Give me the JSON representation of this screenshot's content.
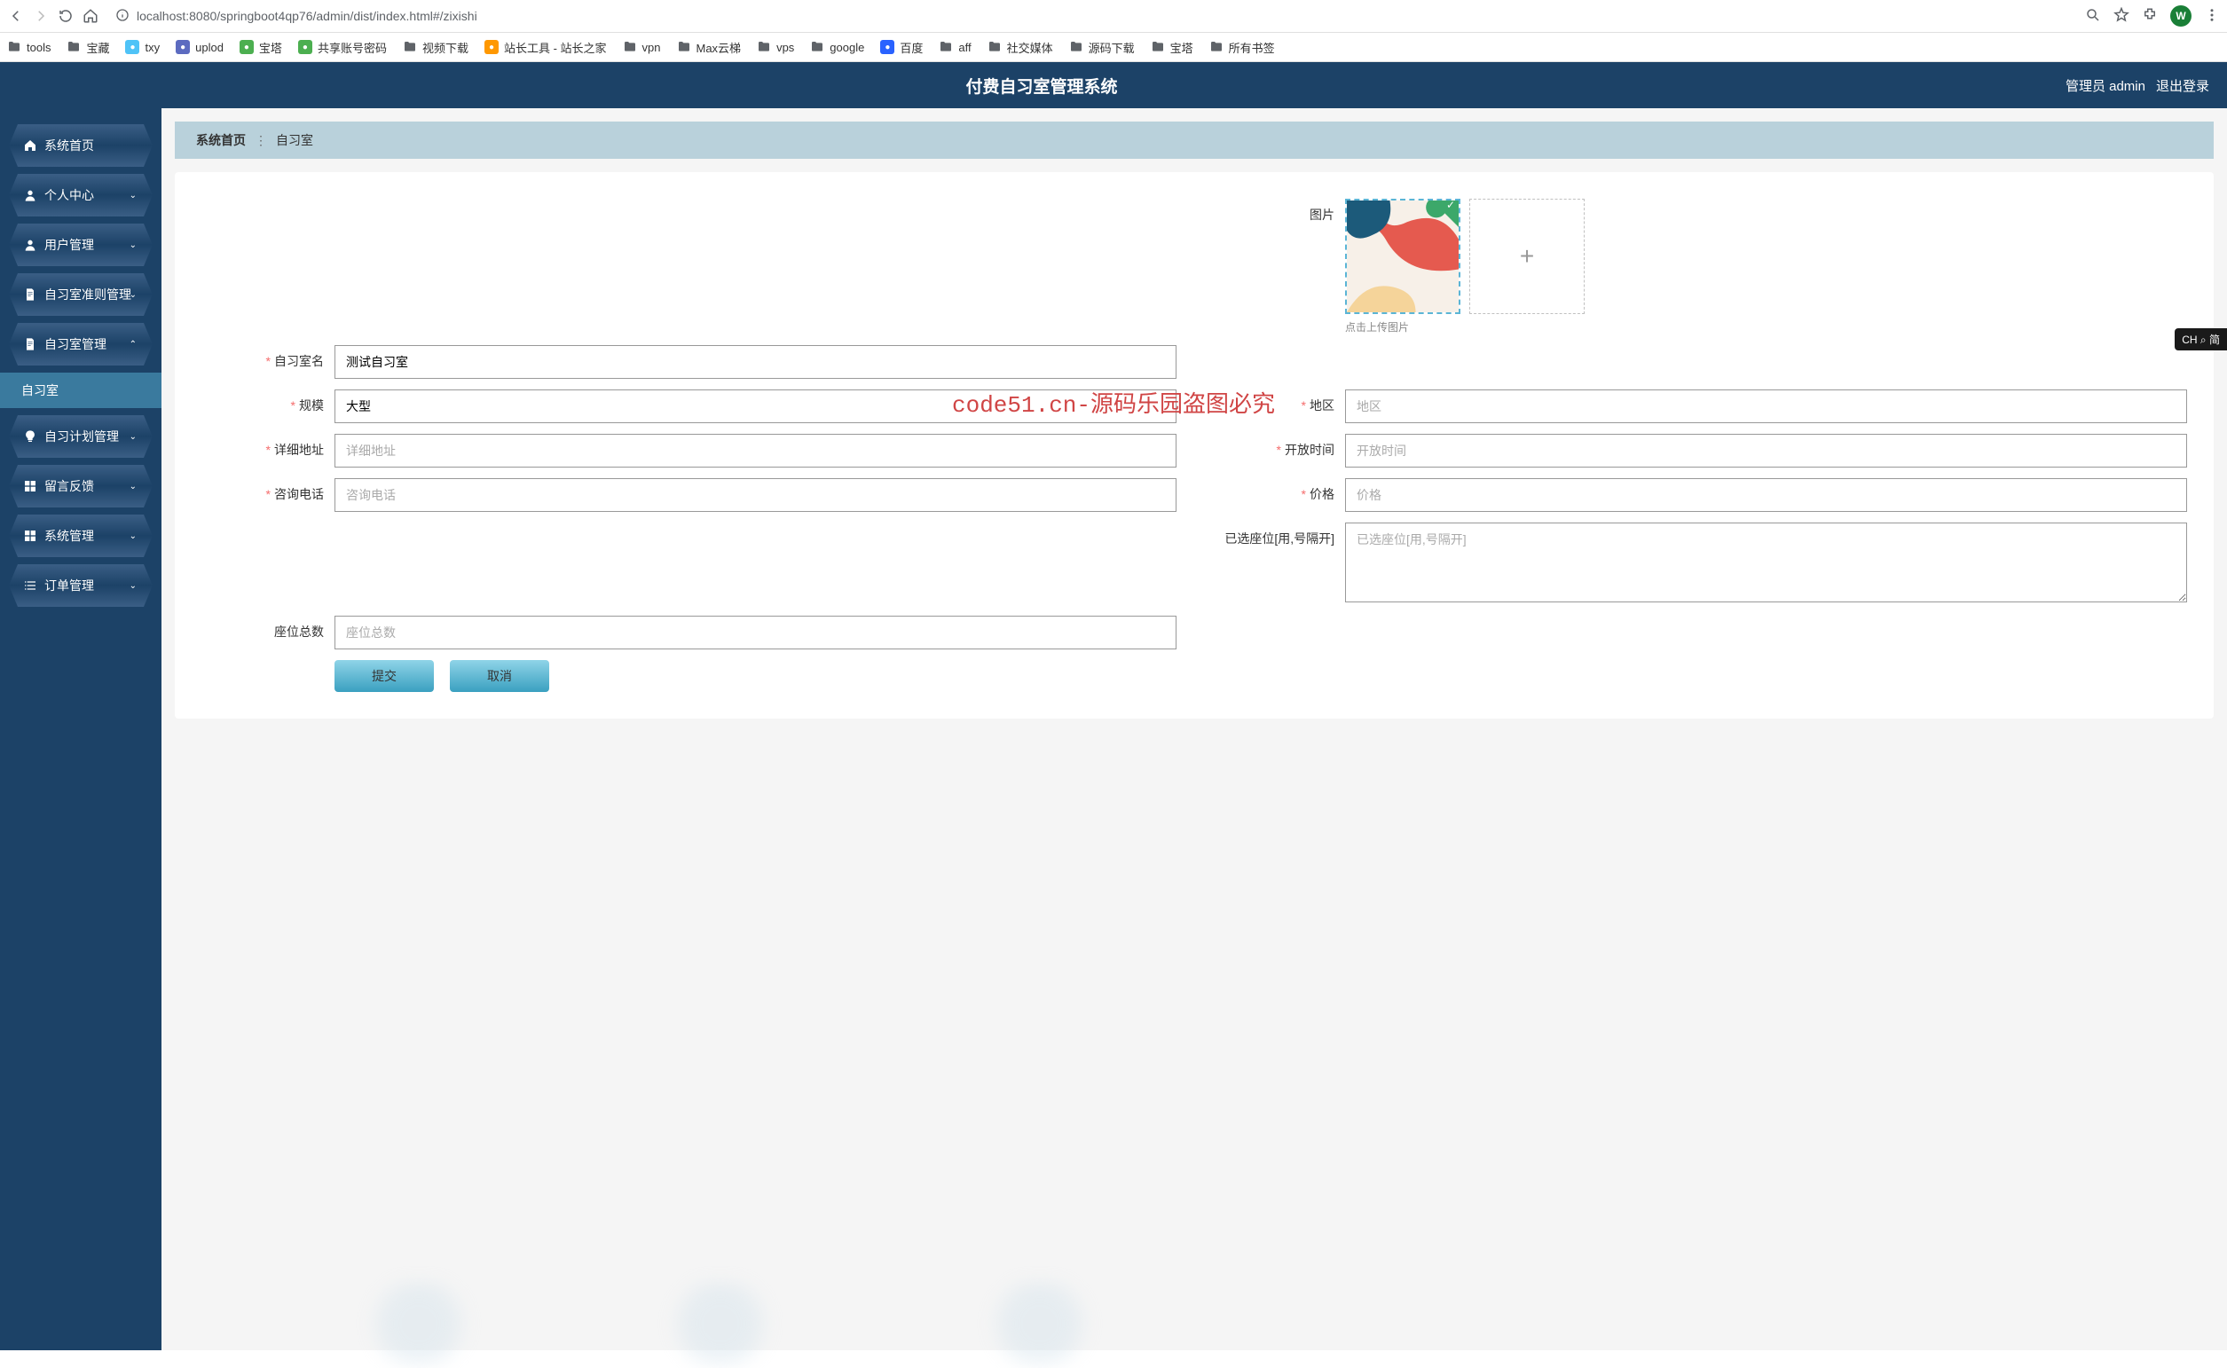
{
  "browser": {
    "url": "localhost:8080/springboot4qp76/admin/dist/index.html#/zixishi",
    "avatar_letter": "W"
  },
  "bookmarks": [
    {
      "icon": "folder",
      "label": "tools"
    },
    {
      "icon": "folder",
      "label": "宝藏"
    },
    {
      "icon": "txy",
      "label": "txy",
      "color": "#4fc3f7"
    },
    {
      "icon": "upload",
      "label": "uplod",
      "color": "#5c6bc0"
    },
    {
      "icon": "baota",
      "label": "宝塔",
      "color": "#4caf50"
    },
    {
      "icon": "sheet",
      "label": "共享账号密码",
      "color": "#4caf50"
    },
    {
      "icon": "folder",
      "label": "视频下载"
    },
    {
      "icon": "zz",
      "label": "站长工具 - 站长之家",
      "color": "#ff9800"
    },
    {
      "icon": "folder",
      "label": "vpn"
    },
    {
      "icon": "folder",
      "label": "Max云梯"
    },
    {
      "icon": "folder",
      "label": "vps"
    },
    {
      "icon": "folder",
      "label": "google"
    },
    {
      "icon": "baidu",
      "label": "百度",
      "color": "#2962ff"
    },
    {
      "icon": "folder",
      "label": "aff"
    },
    {
      "icon": "folder",
      "label": "社交媒体"
    },
    {
      "icon": "folder",
      "label": "源码下载"
    },
    {
      "icon": "folder",
      "label": "宝塔"
    },
    {
      "icon": "folder",
      "label": "所有书签"
    }
  ],
  "header": {
    "title": "付费自习室管理系统",
    "admin_label": "管理员 admin",
    "logout_label": "退出登录"
  },
  "sidebar": [
    {
      "icon": "home",
      "label": "系统首页",
      "has_children": false
    },
    {
      "icon": "user",
      "label": "个人中心",
      "has_children": true,
      "expanded": false
    },
    {
      "icon": "user",
      "label": "用户管理",
      "has_children": true,
      "expanded": false
    },
    {
      "icon": "doc",
      "label": "自习室准则管理",
      "has_children": true,
      "expanded": false
    },
    {
      "icon": "doc",
      "label": "自习室管理",
      "has_children": true,
      "expanded": true,
      "children": [
        "自习室"
      ]
    },
    {
      "icon": "bulb",
      "label": "自习计划管理",
      "has_children": true,
      "expanded": false
    },
    {
      "icon": "grid",
      "label": "留言反馈",
      "has_children": true,
      "expanded": false
    },
    {
      "icon": "grid",
      "label": "系统管理",
      "has_children": true,
      "expanded": false
    },
    {
      "icon": "list",
      "label": "订单管理",
      "has_children": true,
      "expanded": false
    }
  ],
  "breadcrumb": {
    "home": "系统首页",
    "current": "自习室"
  },
  "form": {
    "image_label": "图片",
    "image_hint": "点击上传图片",
    "room_name_label": "自习室名",
    "room_name_value": "测试自习室",
    "scale_label": "规模",
    "scale_value": "大型",
    "region_label": "地区",
    "region_placeholder": "地区",
    "address_label": "详细地址",
    "address_placeholder": "详细地址",
    "open_time_label": "开放时间",
    "open_time_placeholder": "开放时间",
    "phone_label": "咨询电话",
    "phone_placeholder": "咨询电话",
    "price_label": "价格",
    "price_placeholder": "价格",
    "selected_seats_label": "已选座位[用,号隔开]",
    "selected_seats_placeholder": "已选座位[用,号隔开]",
    "total_seats_label": "座位总数",
    "total_seats_placeholder": "座位总数",
    "submit_label": "提交",
    "cancel_label": "取消"
  },
  "ime": "CH ⌕ 简",
  "big_watermark": "code51.cn-源码乐园盗图必究",
  "watermark": "code51.cn"
}
